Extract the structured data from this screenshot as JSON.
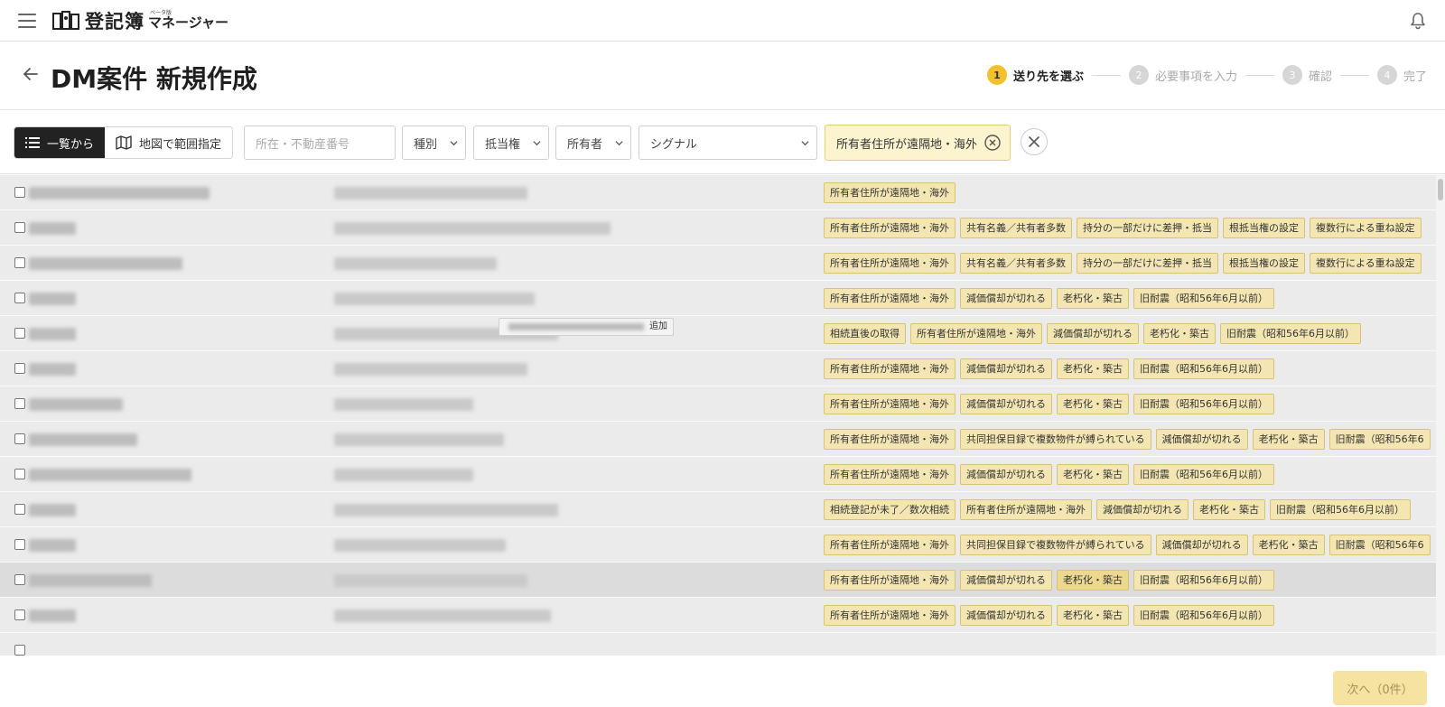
{
  "app": {
    "logo_main": "登記簿",
    "logo_small": "ベータ版",
    "logo_sub": "マネージャー"
  },
  "page": {
    "title": "DM案件 新規作成"
  },
  "stepper": [
    {
      "num": "1",
      "label": "送り先を選ぶ",
      "state": "active"
    },
    {
      "num": "2",
      "label": "必要事項を入力",
      "state": "inactive"
    },
    {
      "num": "3",
      "label": "確認",
      "state": "inactive"
    },
    {
      "num": "4",
      "label": "完了",
      "state": "inactive"
    }
  ],
  "filters": {
    "view_list_label": "一覧から",
    "view_map_label": "地図で範囲指定",
    "search_placeholder": "所在・不動産番号",
    "type_label": "種別",
    "mortgage_label": "抵当権",
    "owner_label": "所有者",
    "signal_label": "シグナル",
    "active_signal": "所有者住所が遠隔地・海外"
  },
  "rows": [
    {
      "tags": [
        "所有者住所が遠隔地・海外"
      ]
    },
    {
      "tags": [
        "所有者住所が遠隔地・海外",
        "共有名義／共有者多数",
        "持分の一部だけに差押・抵当",
        "根抵当権の設定",
        "複数行による重ね設定"
      ]
    },
    {
      "tags": [
        "所有者住所が遠隔地・海外",
        "共有名義／共有者多数",
        "持分の一部だけに差押・抵当",
        "根抵当権の設定",
        "複数行による重ね設定"
      ]
    },
    {
      "tags": [
        "所有者住所が遠隔地・海外",
        "減価償却が切れる",
        "老朽化・築古",
        "旧耐震（昭和56年6月以前）"
      ]
    },
    {
      "tags": [
        "相続直後の取得",
        "所有者住所が遠隔地・海外",
        "減価償却が切れる",
        "老朽化・築古",
        "旧耐震（昭和56年6月以前）"
      ]
    },
    {
      "tags": [
        "所有者住所が遠隔地・海外",
        "減価償却が切れる",
        "老朽化・築古",
        "旧耐震（昭和56年6月以前）"
      ]
    },
    {
      "tags": [
        "所有者住所が遠隔地・海外",
        "減価償却が切れる",
        "老朽化・築古",
        "旧耐震（昭和56年6月以前）"
      ]
    },
    {
      "tags": [
        "所有者住所が遠隔地・海外",
        "共同担保目録で複数物件が縛られている",
        "減価償却が切れる",
        "老朽化・築古",
        "旧耐震（昭和56年6"
      ]
    },
    {
      "tags": [
        "所有者住所が遠隔地・海外",
        "減価償却が切れる",
        "老朽化・築古",
        "旧耐震（昭和56年6月以前）"
      ]
    },
    {
      "tags": [
        "相続登記が未了／数次相続",
        "所有者住所が遠隔地・海外",
        "減価償却が切れる",
        "老朽化・築古",
        "旧耐震（昭和56年6月以前）"
      ]
    },
    {
      "tags": [
        "所有者住所が遠隔地・海外",
        "共同担保目録で複数物件が縛られている",
        "減価償却が切れる",
        "老朽化・築古",
        "旧耐震（昭和56年6"
      ]
    },
    {
      "tags": [
        "所有者住所が遠隔地・海外",
        "減価償却が切れる",
        "老朽化・築古",
        "旧耐震（昭和56年6月以前）"
      ],
      "highlight": true
    },
    {
      "tags": [
        "所有者住所が遠隔地・海外",
        "減価償却が切れる",
        "老朽化・築古",
        "旧耐震（昭和56年6月以前）"
      ]
    },
    {
      "tags": []
    }
  ],
  "tooltip": {
    "suffix": "追加"
  },
  "footer": {
    "next_label": "次へ（0件）"
  },
  "colors": {
    "accent": "#f2c12e",
    "tag_bg": "#f4e6b2",
    "chip_bg": "#fcf3cf",
    "next_bg": "#f6e3a2"
  }
}
